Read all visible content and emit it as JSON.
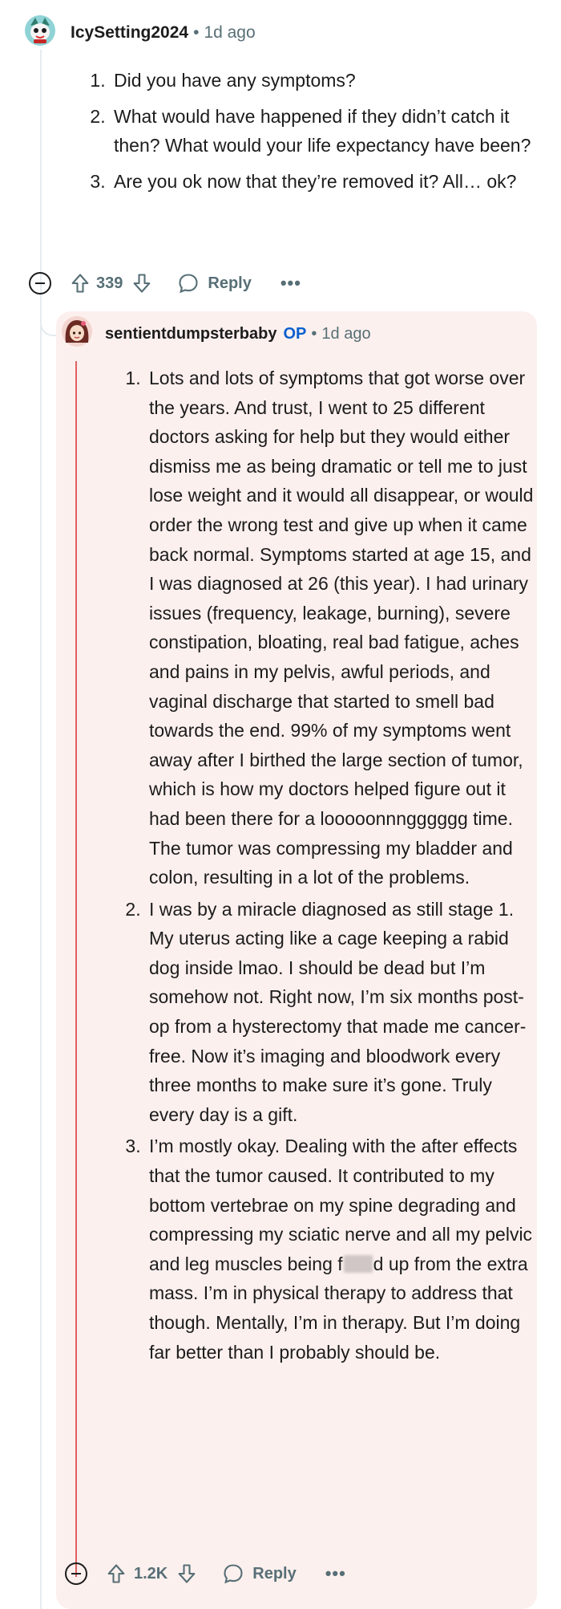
{
  "parent_comment": {
    "username": "IcySetting2024",
    "timestamp": "1d ago",
    "items": [
      "Did you have any symptoms?",
      "What would have happened if they didn’t catch it then? What would your life expectancy have been?",
      "Are you ok now that they’re removed it? All… ok?"
    ],
    "vote_count": "339",
    "reply_label": "Reply",
    "more_label": "•••"
  },
  "reply_comment": {
    "username": "sentientdumpsterbaby",
    "op_badge": "OP",
    "timestamp": "1d ago",
    "items": [
      "Lots and lots of symptoms that got worse over the years. And trust, I went to 25 different doctors asking for help but they would either dismiss me as being dramatic or tell me to just lose weight and it would all disappear, or would order the wrong test and give up when it came back normal. Symptoms started at age 15, and I was diagnosed at 26 (this year). I had urinary issues (frequency, leakage, burning), severe constipation, bloating, real bad fatigue, aches and pains in my pelvis, awful periods, and vaginal discharge that started to smell bad towards the end. 99% of my symptoms went away after I birthed the large section of tumor, which is how my doctors helped figure out it had been there for a looooonnngggggg time. The tumor was compressing my bladder and colon, resulting in a lot of the problems.",
      "I was by a miracle diagnosed as still stage 1. My uterus acting like a cage keeping a rabid dog inside lmao. I should be dead but I’m somehow not. Right now, I’m six months post-op from a hysterectomy that made me cancer-free. Now it’s imaging and bloodwork every three months to make sure it’s gone. Truly every day is a gift."
    ],
    "item3_part1": "I’m mostly okay. Dealing with the after effects that the tumor caused. It contributed to my bottom vertebrae on my spine degrading and compressing my sciatic nerve and all my pelvic and leg muscles being f",
    "item3_part2": "d up from the extra mass. I’m in physical therapy to address that though. Mentally, I’m in therapy. But I’m doing far better than I probably should be.",
    "vote_count": "1.2K",
    "reply_label": "Reply",
    "more_label": "•••"
  },
  "colors": {
    "accent_op": "#0b5fd0",
    "highlight_bg": "#fcf0ee",
    "thread_line_highlight": "#e06060",
    "meta_gray": "#576f76"
  },
  "icons": {
    "upvote": "arrow-up-icon",
    "downvote": "arrow-down-icon",
    "reply": "speech-bubble-icon",
    "collapse": "minus-circle-icon"
  }
}
